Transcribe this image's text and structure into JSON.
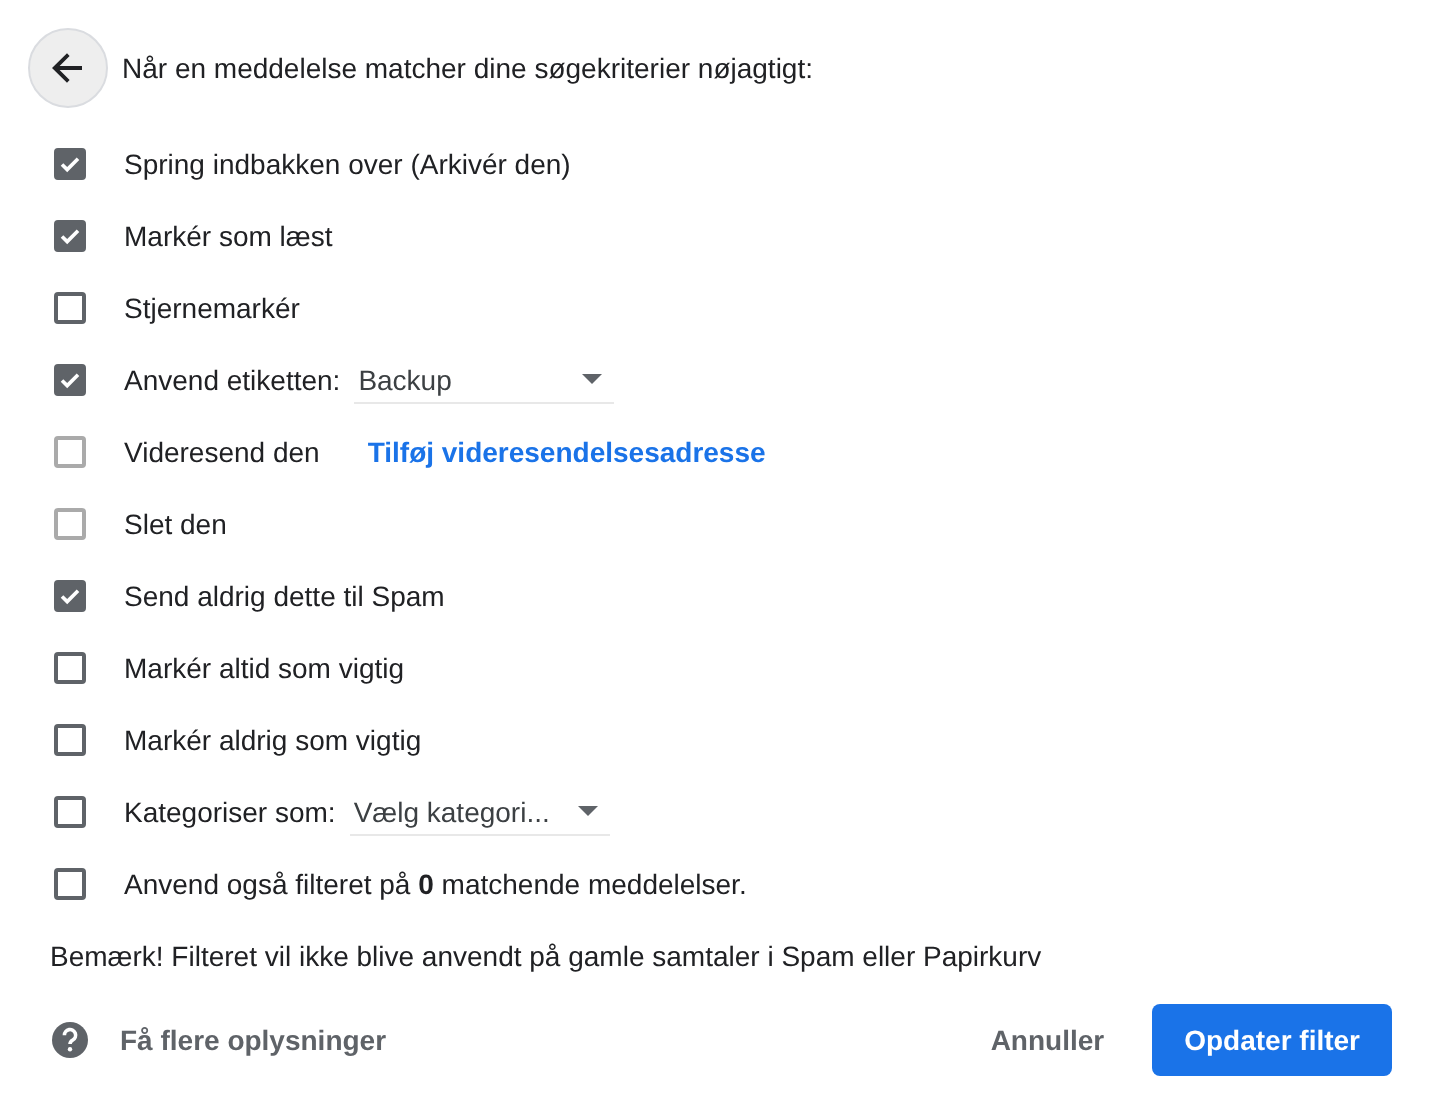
{
  "header": {
    "title": "Når en meddelelse matcher dine søgekriterier nøjagtigt:"
  },
  "options": [
    {
      "kind": "plain",
      "label": "Spring indbakken over (Arkivér den)",
      "checked": true,
      "disabled": false
    },
    {
      "kind": "plain",
      "label": "Markér som læst",
      "checked": true,
      "disabled": false
    },
    {
      "kind": "plain",
      "label": "Stjernemarkér",
      "checked": false,
      "disabled": false
    },
    {
      "kind": "select",
      "label": "Anvend etiketten:",
      "value": "Backup",
      "checked": true,
      "disabled": false
    },
    {
      "kind": "link",
      "label": "Videresend den",
      "link": "Tilføj videresendelsesadresse",
      "checked": false,
      "disabled": true
    },
    {
      "kind": "plain",
      "label": "Slet den",
      "checked": false,
      "disabled": true
    },
    {
      "kind": "plain",
      "label": "Send aldrig dette til Spam",
      "checked": true,
      "disabled": false
    },
    {
      "kind": "plain",
      "label": "Markér altid som vigtig",
      "checked": false,
      "disabled": false
    },
    {
      "kind": "plain",
      "label": "Markér aldrig som vigtig",
      "checked": false,
      "disabled": false
    },
    {
      "kind": "select",
      "label": "Kategoriser som:",
      "value": "Vælg kategori...",
      "checked": false,
      "disabled": false
    },
    {
      "kind": "plain",
      "label": "Anvend også filteret på **0** matchende meddelelser.",
      "checked": false,
      "disabled": false
    }
  ],
  "note": "Bemærk! Filteret vil ikke blive anvendt på gamle samtaler i Spam eller Papirkurv",
  "footer": {
    "help": "Få flere oplysninger",
    "cancel": "Annuller",
    "submit": "Opdater filter"
  }
}
